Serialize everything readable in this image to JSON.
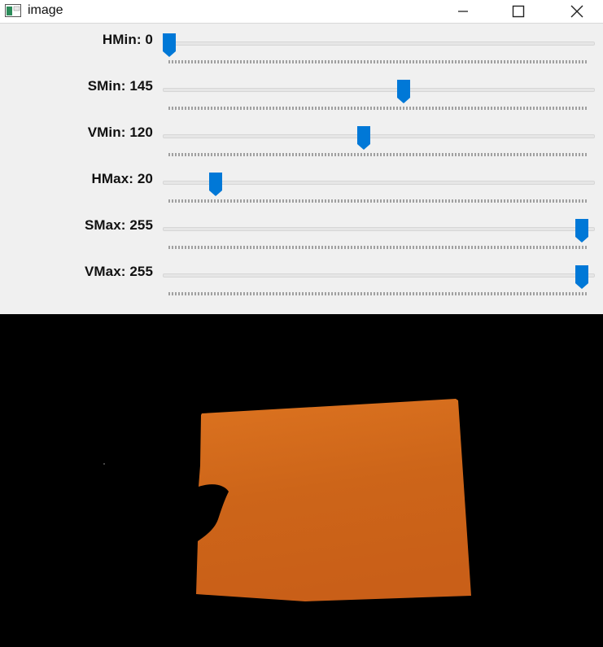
{
  "window": {
    "title": "image",
    "buttons": {
      "minimize": "minimize-icon",
      "maximize": "maximize-icon",
      "close": "close-icon"
    }
  },
  "trackbars": [
    {
      "label": "HMin: 0",
      "name": "HMin",
      "value": 0,
      "max": 179
    },
    {
      "label": "SMin: 145",
      "name": "SMin",
      "value": 145,
      "max": 255
    },
    {
      "label": "VMin: 120",
      "name": "VMin",
      "value": 120,
      "max": 255
    },
    {
      "label": "HMax: 20",
      "name": "HMax",
      "value": 20,
      "max": 179
    },
    {
      "label": "SMax: 255",
      "name": "SMax",
      "value": 255,
      "max": 255
    },
    {
      "label": "VMax: 255",
      "name": "VMax",
      "value": 255,
      "max": 255
    }
  ],
  "colors": {
    "thumb": "#0078d7",
    "panel_bg": "#f0f0f0",
    "mask_bg": "#000000",
    "object_fill": "#d06a1c"
  },
  "image": {
    "content": "orange object on black background (masked)"
  }
}
